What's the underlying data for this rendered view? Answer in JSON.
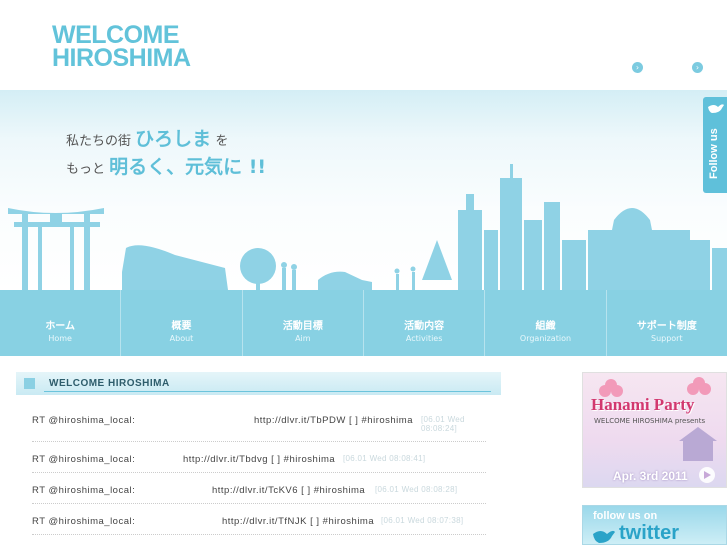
{
  "header": {
    "logo_line1": "WELCOME",
    "logo_line2": "HIROSHIMA",
    "btn1": "›",
    "btn2": "›"
  },
  "hero": {
    "line1_pre": "私たちの街",
    "line1_big": "ひろしま",
    "line1_post": "を",
    "line2_pre": "もっと",
    "line2_big": "明るく、元気に !!"
  },
  "follow_tab": "Follow us",
  "nav": [
    {
      "jp": "ホーム",
      "en": "Home"
    },
    {
      "jp": "概要",
      "en": "About"
    },
    {
      "jp": "活動目標",
      "en": "Aim"
    },
    {
      "jp": "活動内容",
      "en": "Activities"
    },
    {
      "jp": "組織",
      "en": "Organization"
    },
    {
      "jp": "サポート制度",
      "en": "Support"
    }
  ],
  "main": {
    "section_title": "WELCOME HIROSHIMA",
    "tweets": [
      {
        "user": "RT @hiroshima_local:",
        "link": "http://dlvr.it/TbPDW [ ] #hiroshima",
        "time": "[06.01 Wed 08:08:24]"
      },
      {
        "user": "RT @hiroshima_local:",
        "link": "http://dlvr.it/Tbdvg [ ] #hiroshima",
        "time": "[06.01 Wed 08:08:41]"
      },
      {
        "user": "RT @hiroshima_local:",
        "link": "http://dlvr.it/TcKV6 [ ] #hiroshima",
        "time": "[06.01 Wed 08:08:28]"
      },
      {
        "user": "RT @hiroshima_local:",
        "link": "http://dlvr.it/TfNJK [ ] #hiroshima",
        "time": "[06.01 Wed 08:07:38]"
      }
    ]
  },
  "sidebar": {
    "hanami_title": "Hanami Party",
    "hanami_presents": "WELCOME HIROSHIMA presents",
    "hanami_date": "Apr. 3rd 2011",
    "twitter_follow": "follow us on",
    "twitter_brand": "twitter"
  },
  "colors": {
    "accent": "#62c3da",
    "nav": "#88d1e3"
  }
}
